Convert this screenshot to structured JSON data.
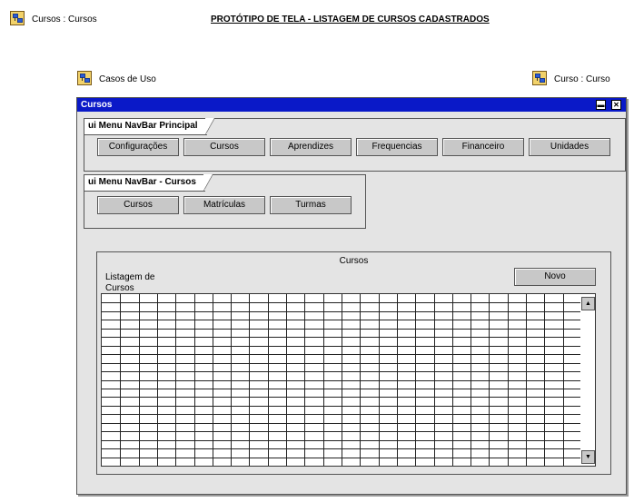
{
  "header": {
    "breadcrumb": "Cursos : Cursos",
    "title": "PROTÓTIPO DE TELA - LISTAGEM DE CURSOS CADASTRADOS"
  },
  "links": {
    "use_cases": "Casos de Uso",
    "course": "Curso : Curso"
  },
  "window": {
    "title": "Cursos",
    "minimize_glyph": "▬",
    "close_glyph": "✕"
  },
  "nav_principal": {
    "label": "ui Menu NavBar Principal",
    "items": [
      "Configurações",
      "Cursos",
      "Aprendizes",
      "Frequencias",
      "Financeiro",
      "Unidades"
    ]
  },
  "nav_cursos": {
    "label": "ui Menu NavBar - Cursos",
    "items": [
      "Cursos",
      "Matrículas",
      "Turmas"
    ]
  },
  "panel": {
    "title": "Cursos",
    "list_label": "Listagem de Cursos",
    "new_button": "Novo"
  },
  "grid": {
    "columns": 26,
    "rows": 20
  },
  "scrollbar": {
    "up_glyph": "▲",
    "down_glyph": "▼"
  },
  "colors": {
    "titlebar": "#0a19c8",
    "window_bg": "#e4e4e4",
    "button_bg": "#c8c8c8"
  }
}
